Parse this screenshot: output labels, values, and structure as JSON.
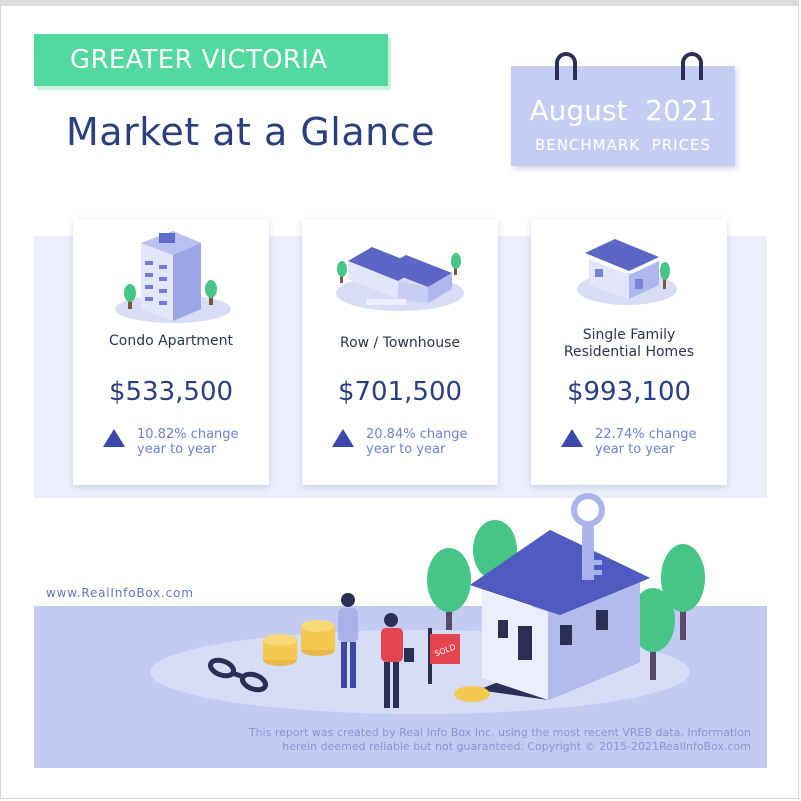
{
  "header": {
    "region": "GREATER VICTORIA",
    "title": "Market at a Glance"
  },
  "calendar": {
    "month_year": "August  2021",
    "subtitle": "BENCHMARK  PRICES"
  },
  "cards": [
    {
      "label_line1": "",
      "label_line2": "Condo Apartment",
      "price": "$533,500",
      "change_line1": "10.82% change",
      "change_line2": "year to year",
      "icon": "condo-building-icon"
    },
    {
      "label_line1": "",
      "label_line2": "Row / Townhouse",
      "price": "$701,500",
      "change_line1": "20.84% change",
      "change_line2": "year to year",
      "icon": "townhouse-icon"
    },
    {
      "label_line1": "Single Family",
      "label_line2": "Residential Homes",
      "price": "$993,100",
      "change_line1": "22.74% change",
      "change_line2": "year to year",
      "icon": "house-icon"
    }
  ],
  "website": "www.RealInfoBox.com",
  "sold_sign": "SOLD",
  "footer": {
    "line1": "This report was created by Real Info Box Inc. using the most recent VREB data. Information",
    "line2": "herein deemed reliable but not guaranteed. Copyright © 2015-2021RealInfoBox.com"
  },
  "colors": {
    "accent_green": "#52d9a0",
    "title_navy": "#2c3e80",
    "calendar": "#c5cdf3",
    "arrow": "#3c48a8",
    "change_text": "#6f7fd6"
  }
}
